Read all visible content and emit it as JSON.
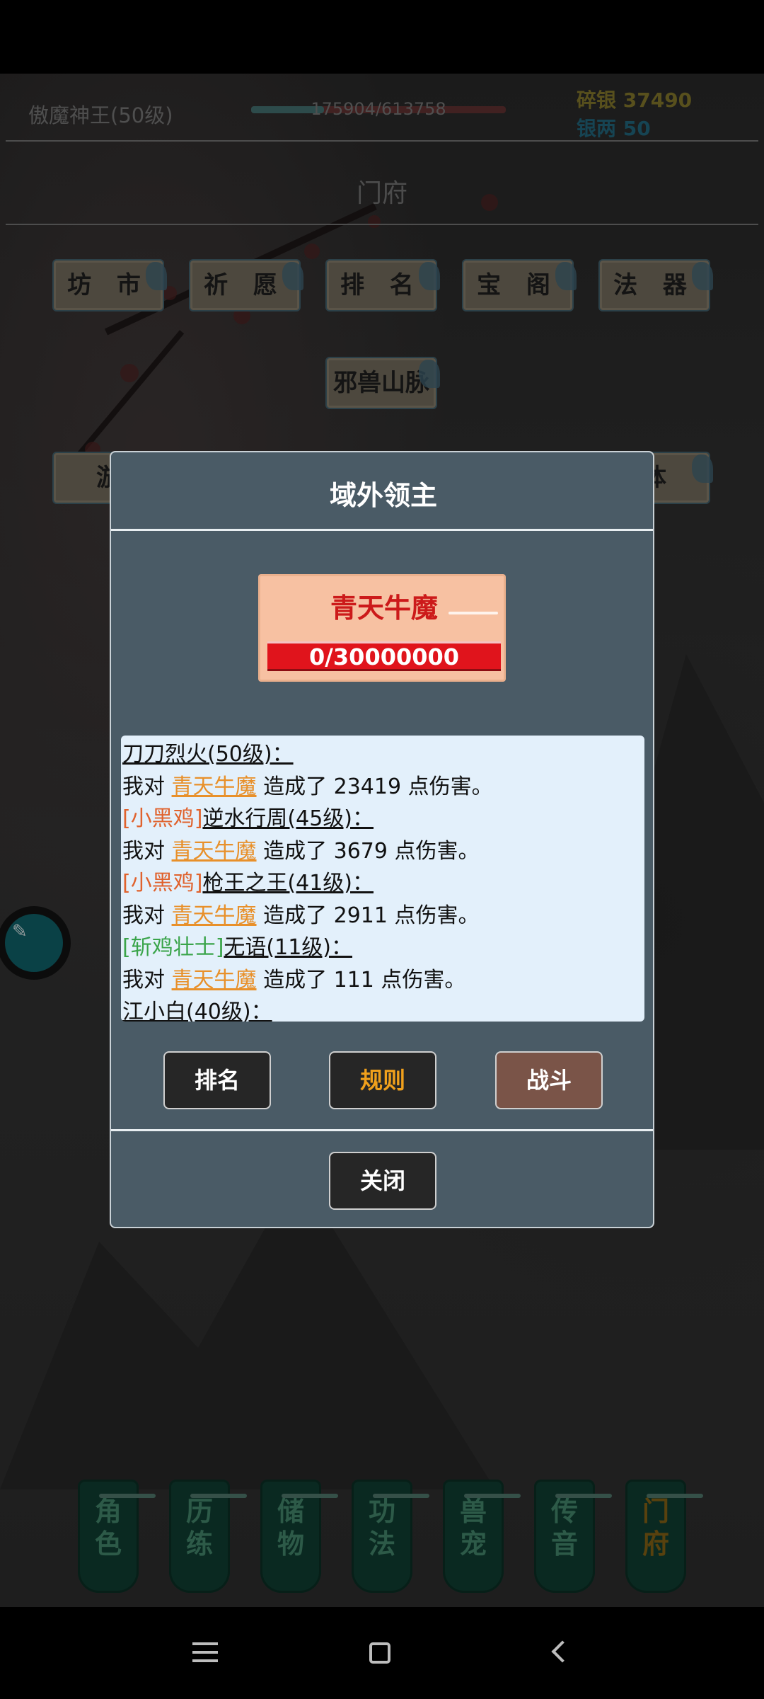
{
  "header": {
    "player_name": "傲魔神王(50级)",
    "exp_text": "175904/613758",
    "exp_fraction": 0.287,
    "silver_broken": "碎银 37490",
    "silver_tael": "银两 50"
  },
  "section_title": "门府",
  "menu": {
    "row1": [
      "坊 市",
      "祈 愿",
      "排 名",
      "宝 阁",
      "法 器"
    ],
    "row2": [
      "邪兽山脉"
    ],
    "row3_left": "游",
    "row3_right": "体"
  },
  "dialog": {
    "title": "域外领主",
    "boss_name": "青天牛魔",
    "boss_hp": "0/30000000",
    "log": [
      {
        "tag": "",
        "name": "刀刀烈火(50级)：",
        "tag_color": ""
      },
      {
        "text_pre": "我对 ",
        "boss": "青天牛魔",
        "text_post": " 造成了 23419 点伤害。"
      },
      {
        "tag": "[小黑鸡]",
        "name": "逆水行周(45级)：",
        "tag_color": "red"
      },
      {
        "text_pre": "我对 ",
        "boss": "青天牛魔",
        "text_post": " 造成了 3679 点伤害。"
      },
      {
        "tag": "[小黑鸡]",
        "name": "枪王之王(41级)：",
        "tag_color": "red"
      },
      {
        "text_pre": "我对 ",
        "boss": "青天牛魔",
        "text_post": " 造成了 2911 点伤害。"
      },
      {
        "tag": "[斩鸡壮士]",
        "name": "无语(11级)：",
        "tag_color": "green"
      },
      {
        "text_pre": "我对 ",
        "boss": "青天牛魔",
        "text_post": " 造成了 111 点伤害。"
      },
      {
        "tag": "",
        "name": "江小白(40级)：",
        "tag_color": ""
      }
    ],
    "buttons": {
      "rank": "排名",
      "rules": "规则",
      "fight": "战斗",
      "close": "关闭"
    }
  },
  "bottom_nav": [
    {
      "line1": "角",
      "line2": "色"
    },
    {
      "line1": "历",
      "line2": "练"
    },
    {
      "line1": "储",
      "line2": "物"
    },
    {
      "line1": "功",
      "line2": "法"
    },
    {
      "line1": "兽",
      "line2": "宠"
    },
    {
      "line1": "传",
      "line2": "音"
    },
    {
      "line1": "门",
      "line2": "府"
    }
  ],
  "colors": {
    "dialog_bg": "#4a5b66",
    "boss_name": "#cc1a1a",
    "boss_ref": "#e8902a",
    "tag_red": "#e0622d",
    "tag_green": "#3aa44a",
    "rules_text": "#f0a01c",
    "fight_bg": "#7a5448"
  },
  "icons": {
    "floating_avatar": "chat-avatar-icon",
    "sys_menu": "menu-icon",
    "sys_home": "home-icon",
    "sys_back": "back-icon"
  }
}
